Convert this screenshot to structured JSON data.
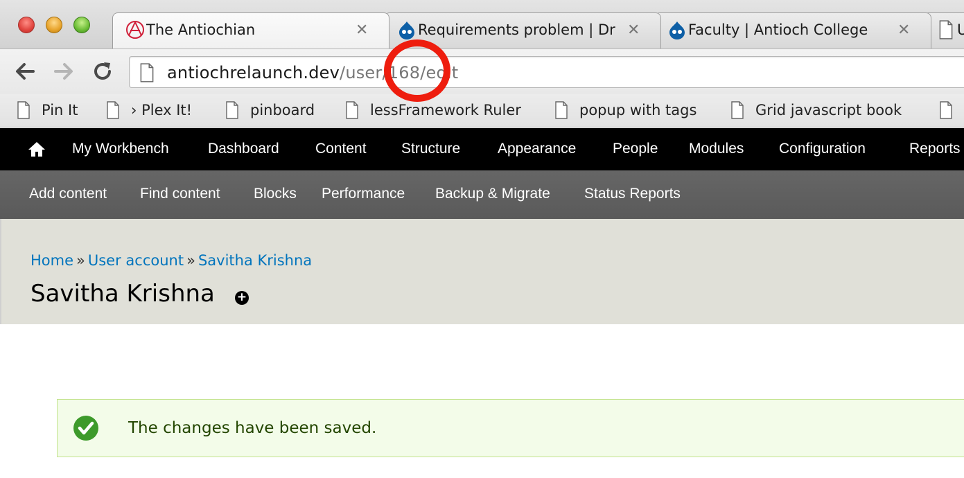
{
  "tabs": [
    {
      "title": "The Antiochian",
      "icon": "antioch-logo-icon",
      "active": true
    },
    {
      "title": "Requirements problem | Dr",
      "icon": "drupal-drop-icon",
      "active": false
    },
    {
      "title": "Faculty | Antioch College",
      "icon": "drupal-drop-icon",
      "active": false
    },
    {
      "title": "U",
      "icon": "page-icon",
      "active": false
    }
  ],
  "address_bar": {
    "host": "antiochrelaunch.dev",
    "path_before": "/user/",
    "user_id": "168",
    "path_after": "/edit",
    "annotation_color": "#ee1d0e"
  },
  "bookmarks": [
    {
      "label": "Pin It"
    },
    {
      "label": "› Plex It!"
    },
    {
      "label": "pinboard"
    },
    {
      "label": "lessFramework Ruler"
    },
    {
      "label": "popup with tags"
    },
    {
      "label": "Grid javascript book"
    },
    {
      "label": ""
    }
  ],
  "admin_menu": [
    {
      "label": "My Workbench"
    },
    {
      "label": "Dashboard"
    },
    {
      "label": "Content"
    },
    {
      "label": "Structure"
    },
    {
      "label": "Appearance"
    },
    {
      "label": "People"
    },
    {
      "label": "Modules"
    },
    {
      "label": "Configuration"
    },
    {
      "label": "Reports"
    }
  ],
  "shortcuts": [
    {
      "label": "Add content"
    },
    {
      "label": "Find content"
    },
    {
      "label": "Blocks"
    },
    {
      "label": "Performance"
    },
    {
      "label": "Backup & Migrate"
    },
    {
      "label": "Status Reports"
    }
  ],
  "breadcrumb": {
    "items": [
      "Home",
      "User account",
      "Savitha Krishna"
    ],
    "separator": "»"
  },
  "page": {
    "title": "Savitha Krishna",
    "add_shortcut_symbol": "+"
  },
  "message": {
    "text": "The changes have been saved.",
    "type": "status",
    "accent_color": "#3d9a2b"
  }
}
